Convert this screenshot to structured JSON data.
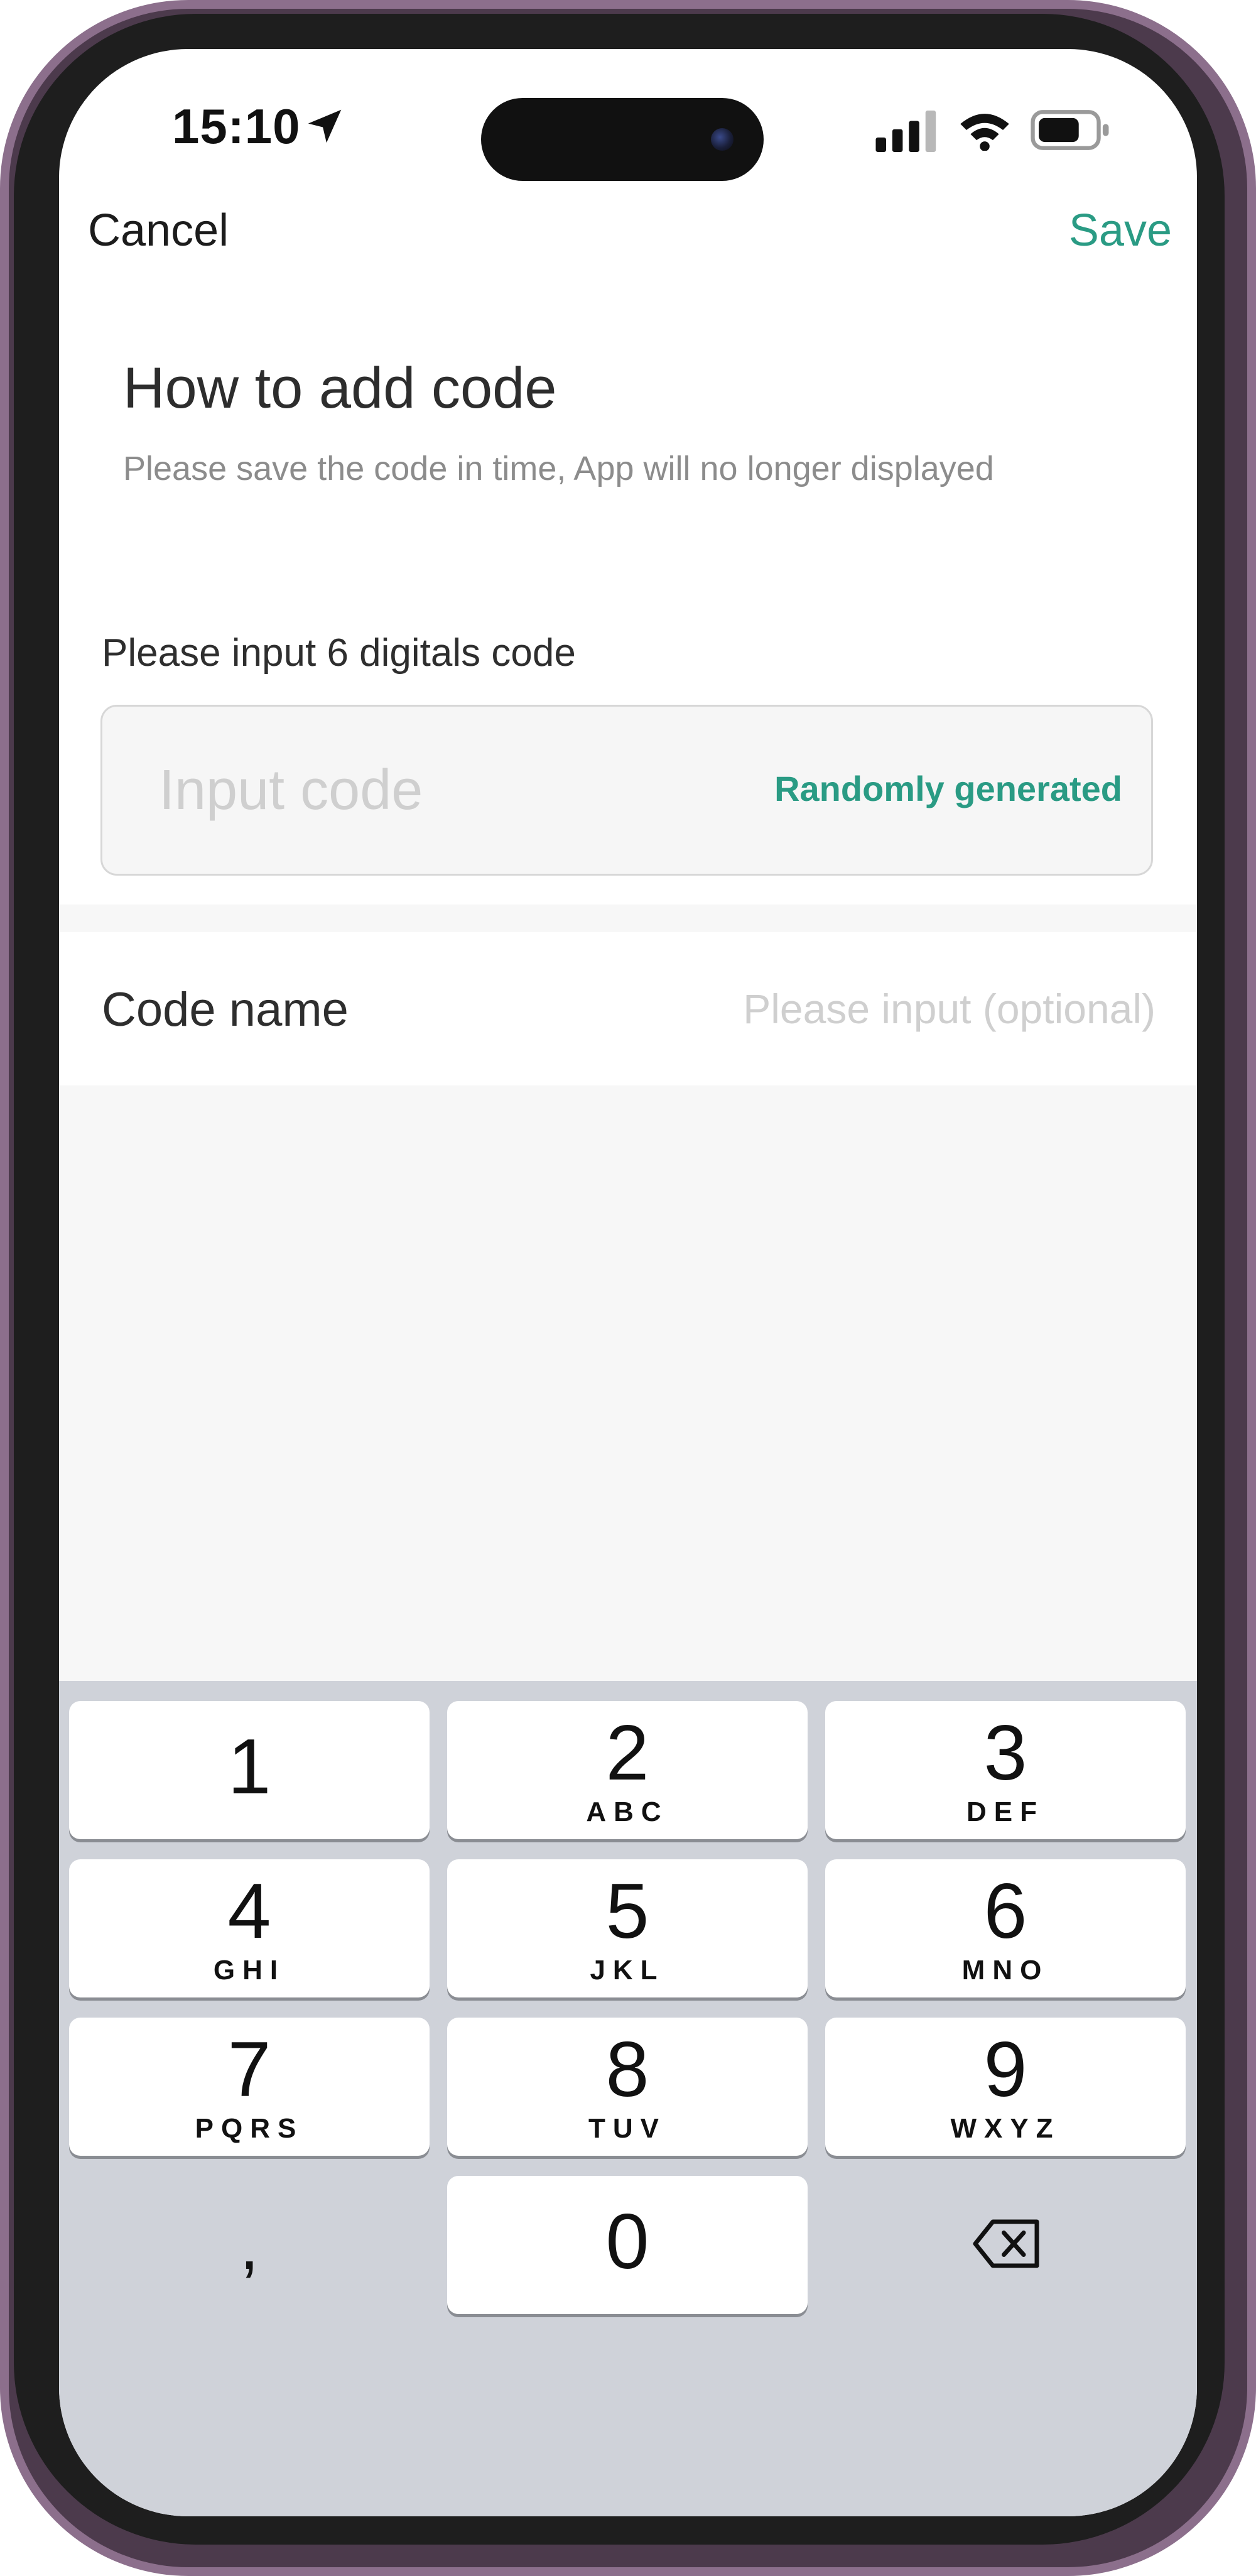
{
  "status_bar": {
    "time": "15:10",
    "icons": [
      "location-arrow-icon",
      "cellular-signal-icon",
      "wifi-icon",
      "battery-icon"
    ]
  },
  "nav": {
    "cancel_label": "Cancel",
    "save_label": "Save"
  },
  "header": {
    "title": "How to add code",
    "subtitle": "Please save the code in time, App will no longer displayed"
  },
  "code_field": {
    "label": "Please input 6 digitals code",
    "placeholder": "Input code",
    "value": "",
    "random_button": "Randomly generated"
  },
  "name_field": {
    "label": "Code name",
    "placeholder": "Please input (optional)",
    "value": ""
  },
  "keyboard": {
    "keys": [
      {
        "digit": "1",
        "letters": ""
      },
      {
        "digit": "2",
        "letters": "ABC"
      },
      {
        "digit": "3",
        "letters": "DEF"
      },
      {
        "digit": "4",
        "letters": "GHI"
      },
      {
        "digit": "5",
        "letters": "JKL"
      },
      {
        "digit": "6",
        "letters": "MNO"
      },
      {
        "digit": "7",
        "letters": "PQRS"
      },
      {
        "digit": "8",
        "letters": "TUV"
      },
      {
        "digit": "9",
        "letters": "WXYZ"
      },
      {
        "digit": "0",
        "letters": ""
      }
    ],
    "comma_label": ",",
    "delete_icon": "backspace-icon"
  },
  "colors": {
    "accent": "#2a9b84",
    "keyboard_bg": "#cfd2d9",
    "key_bg": "#ffffff",
    "frame": "#4c3a4c"
  }
}
